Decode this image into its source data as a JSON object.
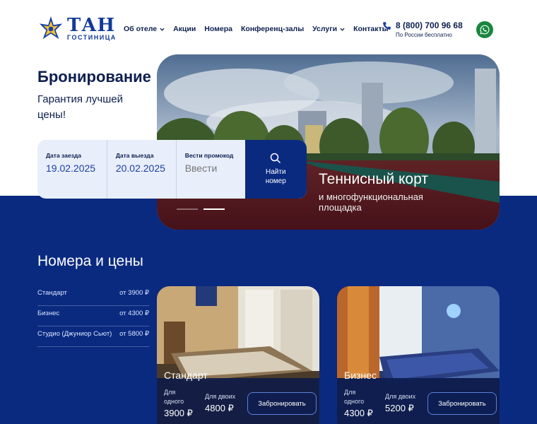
{
  "brand": {
    "name": "ТАН",
    "subtitle": "ГОСТИНИЦА"
  },
  "nav": [
    {
      "label": "Об отеле",
      "dropdown": true
    },
    {
      "label": "Акции",
      "dropdown": false
    },
    {
      "label": "Номера",
      "dropdown": false
    },
    {
      "label": "Конференц-залы",
      "dropdown": false
    },
    {
      "label": "Услуги",
      "dropdown": true
    },
    {
      "label": "Контакты",
      "dropdown": false
    }
  ],
  "phone": {
    "number": "8 (800) 700 96 68",
    "note": "По России бесплатно"
  },
  "hero": {
    "title": "Бронирование",
    "subtitle": "Гарантия лучшей цены!"
  },
  "slide": {
    "title": "Теннисный корт",
    "subtitle": "и многофункциональная площадка"
  },
  "booking": {
    "checkin_label": "Дата заезда",
    "checkin_value": "19.02.2025",
    "checkout_label": "Дата выезда",
    "checkout_value": "20.02.2025",
    "promo_label": "Вести промокод",
    "promo_placeholder": "Ввести",
    "search_label": "Найти номер"
  },
  "rooms": {
    "title": "Номера и цены",
    "list": [
      {
        "name": "Стандарт",
        "price": "от 3900 ₽"
      },
      {
        "name": "Бизнес",
        "price": "от 4300 ₽"
      },
      {
        "name": "Студио (Джуниор Сьют)",
        "price": "от 5800 ₽"
      }
    ],
    "cards": [
      {
        "name": "Стандарт",
        "single_label": "Для одного",
        "single_price": "3900 ₽",
        "double_label": "Для двоих",
        "double_price": "4800 ₽",
        "button": "Забронировать"
      },
      {
        "name": "Бизнес",
        "single_label": "Для одного",
        "single_price": "4300 ₽",
        "double_label": "Для двоих",
        "double_price": "5200 ₽",
        "button": "Забронировать"
      }
    ]
  },
  "colors": {
    "brand_blue": "#0a2a80",
    "accent_blue": "#123a9a",
    "whatsapp": "#19863d"
  }
}
